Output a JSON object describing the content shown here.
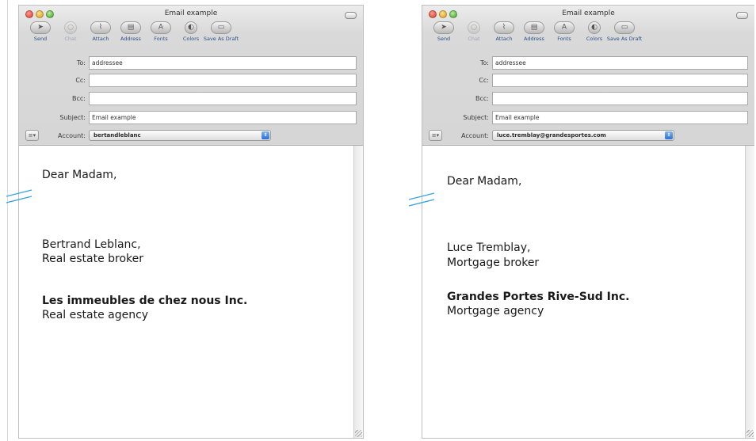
{
  "windows": [
    {
      "title": "Email example",
      "toolbar": [
        {
          "label": "Send",
          "icon": "send-icon",
          "glyph": "➤"
        },
        {
          "label": "Chat",
          "icon": "chat-icon",
          "glyph": "○",
          "disabled": true
        },
        {
          "label": "Attach",
          "icon": "paperclip-icon",
          "glyph": "⌇"
        },
        {
          "label": "Address",
          "icon": "address-book-icon",
          "glyph": "▤"
        },
        {
          "label": "Fonts",
          "icon": "fonts-icon",
          "glyph": "A"
        },
        {
          "label": "Colors",
          "icon": "colors-icon",
          "glyph": "◐"
        },
        {
          "label": "Save As Draft",
          "icon": "draft-icon",
          "glyph": "▭"
        }
      ],
      "fields": {
        "to_label": "To:",
        "to_value": "addressee",
        "cc_label": "Cc:",
        "cc_value": "",
        "bcc_label": "Bcc:",
        "bcc_value": "",
        "subject_label": "Subject:",
        "subject_value": "Email example",
        "account_label": "Account:",
        "account_value": "bertandleblanc",
        "account_menu_glyph": "≡▾"
      },
      "message": {
        "greeting": "Dear Madam,",
        "name": "Bertrand Leblanc,",
        "role": "Real estate broker",
        "company": "Les immeubles de chez nous Inc.",
        "company_type": "Real estate agency"
      }
    },
    {
      "title": "Email example",
      "toolbar": [
        {
          "label": "Send",
          "icon": "send-icon",
          "glyph": "➤"
        },
        {
          "label": "Chat",
          "icon": "chat-icon",
          "glyph": "○",
          "disabled": true
        },
        {
          "label": "Attach",
          "icon": "paperclip-icon",
          "glyph": "⌇"
        },
        {
          "label": "Address",
          "icon": "address-book-icon",
          "glyph": "▤"
        },
        {
          "label": "Fonts",
          "icon": "fonts-icon",
          "glyph": "A"
        },
        {
          "label": "Colors",
          "icon": "colors-icon",
          "glyph": "◐"
        },
        {
          "label": "Save As Draft",
          "icon": "draft-icon",
          "glyph": "▭"
        }
      ],
      "fields": {
        "to_label": "To:",
        "to_value": "addressee",
        "cc_label": "Cc:",
        "cc_value": "",
        "bcc_label": "Bcc:",
        "bcc_value": "",
        "subject_label": "Subject:",
        "subject_value": "Email example",
        "account_label": "Account:",
        "account_value": "luce.tremblay@grandesportes.com",
        "account_menu_glyph": "≡▾"
      },
      "message": {
        "greeting": "Dear Madam,",
        "name": "Luce Tremblay,",
        "role": "Mortgage broker",
        "company": "Grandes Portes Rive-Sud Inc.",
        "company_type": "Mortgage agency"
      }
    }
  ],
  "colors": {
    "break_mark": "#3aa3dc",
    "toolbar_label": "#2b4f8a",
    "account_arrow": "#2b6fd1"
  }
}
